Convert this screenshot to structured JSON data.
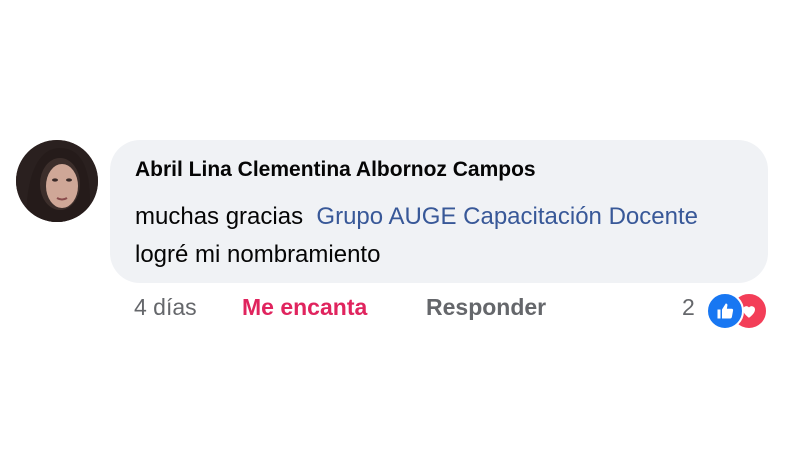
{
  "comment": {
    "author": "Abril Lina Clementina Albornoz Campos",
    "text_before": "muchas gracias",
    "mention": "Grupo AUGE Capacitación Docente",
    "text_after": "logré mi nombramiento",
    "timestamp": "4 días",
    "reaction_label": "Me encanta",
    "reply_label": "Responder",
    "reaction_count": "2",
    "reaction_icons": [
      "like-icon",
      "heart-icon"
    ],
    "colors": {
      "bubble": "#f0f2f5",
      "mention": "#385898",
      "love": "#e0245e",
      "like": "#1877f2",
      "heart": "#f33e58"
    }
  }
}
